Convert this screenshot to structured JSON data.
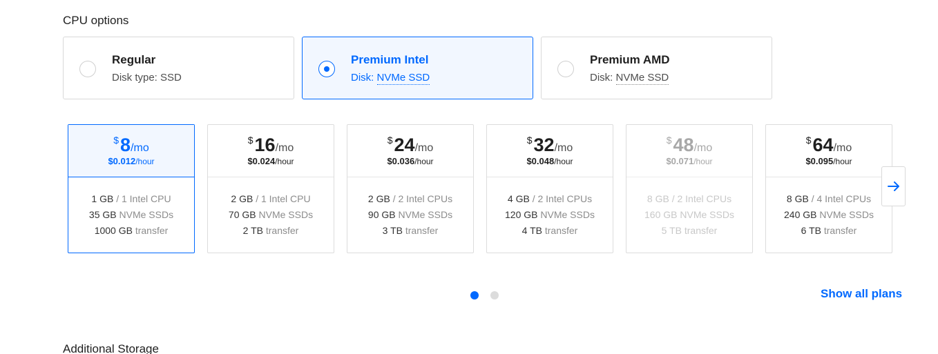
{
  "cpu_options": {
    "title": "CPU options",
    "options": [
      {
        "name": "Regular",
        "disk_prefix": "Disk type: ",
        "disk_value": "SSD"
      },
      {
        "name": "Premium Intel",
        "disk_prefix": "Disk: ",
        "disk_value": "NVMe SSD"
      },
      {
        "name": "Premium AMD",
        "disk_prefix": "Disk: ",
        "disk_value": "NVMe SSD"
      }
    ],
    "selected": "Premium Intel"
  },
  "plans": [
    {
      "currency": "$",
      "amount": "8",
      "per": "/mo",
      "hourly": "$0.012",
      "hour_unit": "/hour",
      "mem": "1 GB",
      "cpu": " / 1 Intel CPU",
      "disk": "35 GB",
      "disk_label": " NVMe SSDs",
      "transfer": "1000 GB",
      "transfer_label": " transfer"
    },
    {
      "currency": "$",
      "amount": "16",
      "per": "/mo",
      "hourly": "$0.024",
      "hour_unit": "/hour",
      "mem": "2 GB",
      "cpu": " / 1 Intel CPU",
      "disk": "70 GB",
      "disk_label": " NVMe SSDs",
      "transfer": "2 TB",
      "transfer_label": " transfer"
    },
    {
      "currency": "$",
      "amount": "24",
      "per": "/mo",
      "hourly": "$0.036",
      "hour_unit": "/hour",
      "mem": "2 GB",
      "cpu": " / 2 Intel CPUs",
      "disk": "90 GB",
      "disk_label": " NVMe SSDs",
      "transfer": "3 TB",
      "transfer_label": " transfer"
    },
    {
      "currency": "$",
      "amount": "32",
      "per": "/mo",
      "hourly": "$0.048",
      "hour_unit": "/hour",
      "mem": "4 GB",
      "cpu": " / 2 Intel CPUs",
      "disk": "120 GB",
      "disk_label": " NVMe SSDs",
      "transfer": "4 TB",
      "transfer_label": " transfer"
    },
    {
      "currency": "$",
      "amount": "48",
      "per": "/mo",
      "hourly": "$0.071",
      "hour_unit": "/hour",
      "mem": "8 GB",
      "cpu": " / 2 Intel CPUs",
      "disk": "160 GB",
      "disk_label": " NVMe SSDs",
      "transfer": "5 TB",
      "transfer_label": " transfer"
    },
    {
      "currency": "$",
      "amount": "64",
      "per": "/mo",
      "hourly": "$0.095",
      "hour_unit": "/hour",
      "mem": "8 GB",
      "cpu": " / 4 Intel CPUs",
      "disk": "240 GB",
      "disk_label": " NVMe SSDs",
      "transfer": "6 TB",
      "transfer_label": " transfer"
    }
  ],
  "pagination": {
    "current_page": 1,
    "total_pages": 2
  },
  "show_all_label": "Show all plans",
  "next_icon": "arrow-right-icon",
  "additional_storage_title": "Additional Storage",
  "colors": {
    "accent": "#0069ff",
    "selected_bg": "#f2f7ff",
    "border": "#d9d9d9",
    "disabled_text": "#c8c8c8"
  }
}
